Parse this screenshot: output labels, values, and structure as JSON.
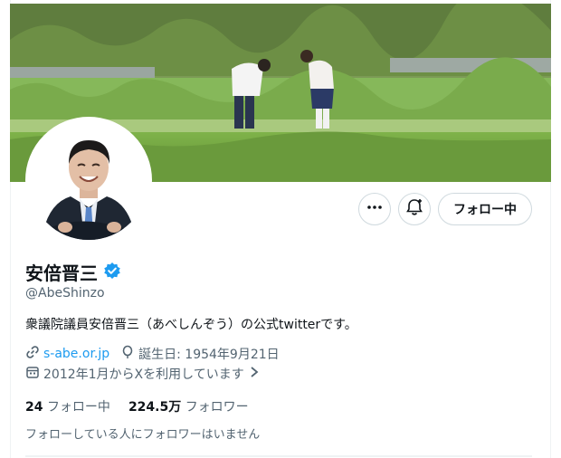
{
  "profile": {
    "display_name": "安倍晋三",
    "handle": "@AbeShinzo",
    "bio": "衆議院議員安倍晋三（あべしんぞう）の公式twitterです。",
    "website": "s-abe.or.jp",
    "birthday": "誕生日: 1954年9月21日",
    "joined": "2012年1月からXを利用しています",
    "verified_color": "#1d9bf0"
  },
  "actions": {
    "follow_label": "フォロー中"
  },
  "stats": {
    "following_count": "24",
    "following_label": "フォロー中",
    "followers_count": "224.5万",
    "followers_label": "フォロワー"
  },
  "known_followers": "フォローしている人にフォロワーはいません",
  "icons": [
    "more-icon",
    "notification-bell-icon",
    "verified-badge-icon",
    "link-icon",
    "balloon-icon",
    "calendar-icon",
    "chevron-right-icon"
  ]
}
